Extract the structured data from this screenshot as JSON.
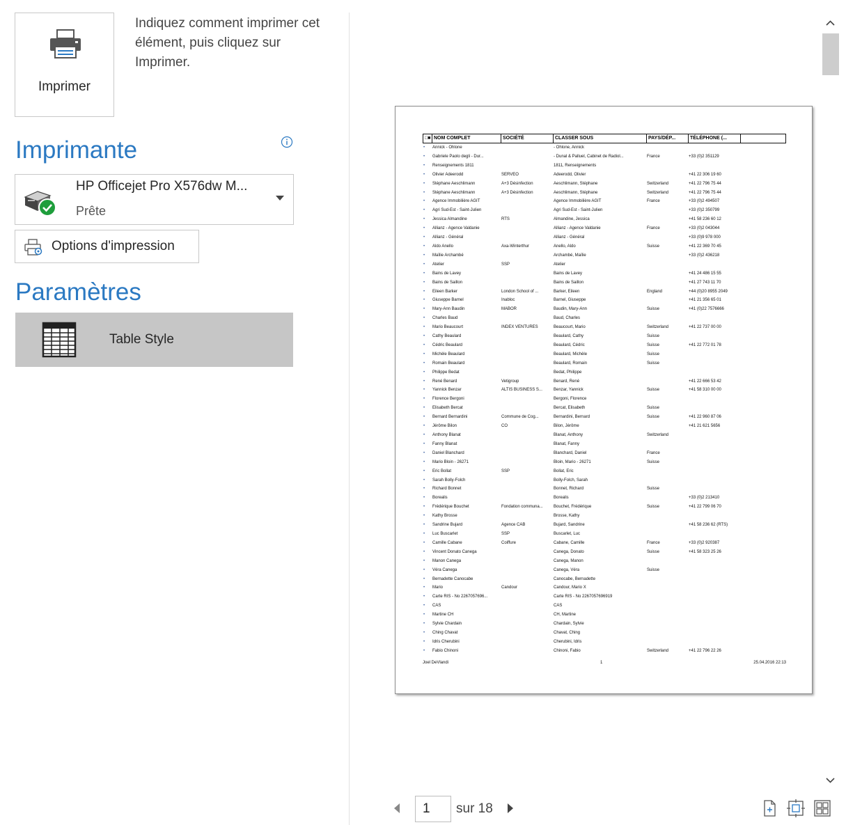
{
  "print": {
    "button_label": "Imprimer",
    "instructions": "Indiquez comment imprimer cet élément, puis cliquez sur Imprimer."
  },
  "printer": {
    "section_title": "Imprimante",
    "name": "HP Officejet Pro X576dw M...",
    "status": "Prête",
    "options_label": "Options d'impression"
  },
  "settings": {
    "section_title": "Paramètres",
    "style_label": "Table Style"
  },
  "preview": {
    "columns": [
      "NOM COMPLET",
      "SOCIÉTÉ",
      "CLASSER SOUS",
      "PAYS/DÉP...",
      "TÉLÉPHONE (..."
    ],
    "rows": [
      [
        "Annick - Ohlone",
        "",
        "- Ohlone, Annick",
        "",
        ""
      ],
      [
        "Gabriele Paolo degli - Dur...",
        "",
        "- Dunal & Palluel, Cabinet de Radiol...",
        "France",
        "+33 (0)2 351129"
      ],
      [
        "Renseignements 1811",
        "",
        "1811, Renseignements",
        "",
        ""
      ],
      [
        "Olivier Adeerodd",
        "SERVEO",
        "Adeerodd, Olivier",
        "",
        "+41 22 306 19 60"
      ],
      [
        "Stéphane Aeschlimann",
        "A+3 Désinfection",
        "Aeschlimann, Stéphane",
        "Switzerland",
        "+41 22 796 75 44"
      ],
      [
        "Stéphane Aeschlimann",
        "A+3 Désinfection",
        "Aeschlimann, Stéphane",
        "Switzerland",
        "+41 22 796 75 44"
      ],
      [
        "Agence Immobilière AGIT",
        "",
        "Agence Immobilière AGIT",
        "France",
        "+33 (0)2 494507"
      ],
      [
        "Agri Sud-Est - Saint-Julien",
        "",
        "Agri Sud-Est - Saint-Julien",
        "",
        "+33 (0)2 350799"
      ],
      [
        "Jessica Almandine",
        "RTS",
        "Almandine, Jessica",
        "",
        "+41 58 236 60 12"
      ],
      [
        "Allianz - Agence Valdanie",
        "",
        "Allianz - Agence Valdanie",
        "France",
        "+33 (0)2 043044"
      ],
      [
        "Allianz - Général",
        "",
        "Allianz - Général",
        "",
        "+33 (0)9 978 000"
      ],
      [
        "Aldo Anello",
        "Axa-Winterthur",
        "Anello, Aldo",
        "Suisse",
        "+41 22 369 70 45"
      ],
      [
        "Maïlie Archambé",
        "",
        "Archambé, Maïlie",
        "",
        "+33 (0)2 436218"
      ],
      [
        "Atelier",
        "SSP",
        "Atelier",
        "",
        ""
      ],
      [
        "Bains de Lavey",
        "",
        "Bains de Lavey",
        "",
        "+41 24 486 15 55"
      ],
      [
        "Bains de Saillon",
        "",
        "Bains de Saillon",
        "",
        "+41 27 743 11 70"
      ],
      [
        "Eileen Barker",
        "London School of ...",
        "Barker, Eileen",
        "England",
        "+44 (0)20 8955 2049"
      ],
      [
        "Giuseppe Barnel",
        "Inabloc",
        "Barnel, Giuseppe",
        "",
        "+41 21 356 65 01"
      ],
      [
        "Mary-Ann Baudin",
        "MABOR",
        "Baudin, Mary-Ann",
        "Suisse",
        "+41 (0)22 7576666"
      ],
      [
        "Charles Baud",
        "",
        "Baud, Charles",
        "",
        ""
      ],
      [
        "Mario Beaucourt",
        "INDEX VENTURES",
        "Beaucourt, Mario",
        "Switzerland",
        "+41 22 737 00 00"
      ],
      [
        "Cathy Beaulard",
        "",
        "Beaulard, Cathy",
        "Suisse",
        ""
      ],
      [
        "Cédric Beaulard",
        "",
        "Beaulard, Cédric",
        "Suisse",
        "+41 22 772 01 78"
      ],
      [
        "Michèle Beaulard",
        "",
        "Beaulard, Michèle",
        "Suisse",
        ""
      ],
      [
        "Romain Beaulard",
        "",
        "Beaulard, Romain",
        "Suisse",
        ""
      ],
      [
        "Philippe Bedat",
        "",
        "Bedat, Philippe",
        "",
        ""
      ],
      [
        "René Benard",
        "Vetigroup",
        "Benard, René",
        "",
        "+41 22 666 53 42"
      ],
      [
        "Yannick Benzar",
        "ALTIS BUSINESS S...",
        "Benzar, Yannick",
        "Suisse",
        "+41 58 310 00 00"
      ],
      [
        "Florence Bergoni",
        "",
        "Bergoni, Florence",
        "",
        ""
      ],
      [
        "Elisabeth Bercat",
        "",
        "Bercat, Elisabeth",
        "Suisse",
        ""
      ],
      [
        "Bernard Bernardini",
        "Commune de Cog...",
        "Bernardini, Bernard",
        "Suisse",
        "+41 22 960 87 06"
      ],
      [
        "Jérôme Bilon",
        "CO",
        "Bilon, Jérôme",
        "",
        "+41 21 621 5656"
      ],
      [
        "Anthony Blanat",
        "",
        "Blanat, Anthony",
        "Switzerland",
        ""
      ],
      [
        "Fanny Blanat",
        "",
        "Blanat, Fanny",
        "",
        ""
      ],
      [
        "Daniel Blanchard",
        "",
        "Blanchard, Daniel",
        "France",
        ""
      ],
      [
        "Mario Bloin - 26271",
        "",
        "Bloin, Mario - 26271",
        "Suisse",
        ""
      ],
      [
        "Eric Bollat",
        "SSP",
        "Bollat, Eric",
        "",
        ""
      ],
      [
        "Sarah Bolly-Folch",
        "",
        "Bolly-Folch, Sarah",
        "",
        ""
      ],
      [
        "Richard Bonnet",
        "",
        "Bonnet, Richard",
        "Suisse",
        ""
      ],
      [
        "Borealis",
        "",
        "Borealis",
        "",
        "+33 (0)2 213410"
      ],
      [
        "Frédérique Bouchet",
        "Fondation communa...",
        "Bouchet, Frédérique",
        "Suisse",
        "+41 22 799 06 70"
      ],
      [
        "Kathy Brosse",
        "",
        "Brosse, Kathy",
        "",
        ""
      ],
      [
        "Sandrine Bujard",
        "Agence CAB",
        "Bujard, Sandrine",
        "",
        "+41 58 236 62 (RTS)"
      ],
      [
        "Luc Buscarlet",
        "SSP",
        "Buscarlet, Luc",
        "",
        ""
      ],
      [
        "Camille Cabane",
        "Coiffure",
        "Cabane, Camille",
        "France",
        "+33 (0)2 920387"
      ],
      [
        "Vincent Donato Canega",
        "",
        "Canega, Donato",
        "Suisse",
        "+41 58 323 25 26"
      ],
      [
        "Manon Canega",
        "",
        "Canega, Manon",
        "",
        ""
      ],
      [
        "Véra Canega",
        "",
        "Canega, Véra",
        "Suisse",
        ""
      ],
      [
        "Bernadette Canocabe",
        "",
        "Canocabe, Bernadette",
        "",
        ""
      ],
      [
        "Mario",
        "Candour",
        "Candour, Mario X",
        "",
        ""
      ],
      [
        "Carte RIS - No 2267057696...",
        "",
        "Carte RIS - No 2267057696919",
        "",
        ""
      ],
      [
        "CAS",
        "",
        "CAS",
        "",
        ""
      ],
      [
        "Martine CH",
        "",
        "CH, Martine",
        "",
        ""
      ],
      [
        "Sylvie Chardain",
        "",
        "Chardain, Sylvie",
        "",
        ""
      ],
      [
        "Ching Chavat",
        "",
        "Chavat, Ching",
        "",
        ""
      ],
      [
        "Idris Cherubini",
        "",
        "Cherubini, Idris",
        "",
        ""
      ],
      [
        "Fabio Chinoni",
        "",
        "Chinoni, Fabio",
        "Switzerland",
        "+41 22 796 22 26"
      ]
    ],
    "footer_left": "Joel DeVlandi",
    "footer_center": "1",
    "footer_right": "25.04.2016 22:13"
  },
  "pager": {
    "current_page": "1",
    "of_label": "sur 18"
  },
  "colors": {
    "accent": "#2b79c2",
    "selected_bg": "#c6c6c6",
    "status_ok": "#1e9e3c"
  },
  "icons": {
    "print": "printer-icon",
    "info": "info-icon",
    "printer_ready": "printer-ready-icon",
    "options": "print-options-icon",
    "table_style": "table-style-icon",
    "view_actual": "actual-size-icon",
    "view_fit": "fit-page-icon",
    "view_multi": "multiple-pages-icon"
  }
}
